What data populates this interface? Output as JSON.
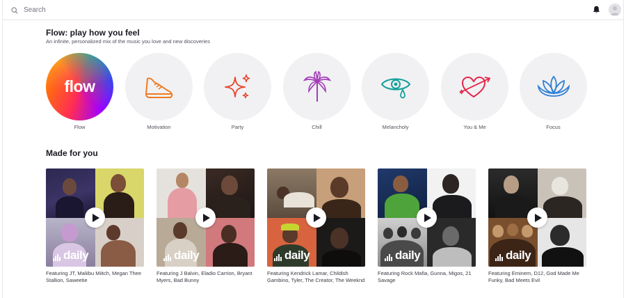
{
  "header": {
    "search_placeholder": "Search"
  },
  "flow_section": {
    "title": "Flow: play how you feel",
    "subtitle": "An infinite, personalized mix of the music you love and new discoveries",
    "flow_word": "flow",
    "moods": [
      {
        "label": "Flow",
        "icon": "flow-logo"
      },
      {
        "label": "Motivation",
        "icon": "sneaker-icon",
        "color": "#f07a22"
      },
      {
        "label": "Party",
        "icon": "sparkles-icon",
        "color": "#e8452b"
      },
      {
        "label": "Chill",
        "icon": "palm-tree-icon",
        "color": "#a33db8"
      },
      {
        "label": "Melancholy",
        "icon": "teary-eye-icon",
        "color": "#14a19a"
      },
      {
        "label": "You & Me",
        "icon": "heart-arrow-icon",
        "color": "#e2284a"
      },
      {
        "label": "Focus",
        "icon": "lotus-icon",
        "color": "#2f7fd6"
      }
    ]
  },
  "made_for_you": {
    "title": "Made for you",
    "badge_text": "daily",
    "cards": [
      {
        "caption": "Featuring JT, Maliibu Miitch, Megan Thee Stallion, Saweetie"
      },
      {
        "caption": "Featuring J Balvin, Eladio Carrion, Bryant Myers, Bad Bunny"
      },
      {
        "caption": "Featuring Kendrick Lamar, Childish Gambino, Tyler, The Creator, The Weeknd"
      },
      {
        "caption": "Featuring Rock Mafia, Gunna, Migos, 21 Savage"
      },
      {
        "caption": "Featuring Eminem, D12, God Made Me Funky, Bad Meets Evil"
      }
    ]
  }
}
